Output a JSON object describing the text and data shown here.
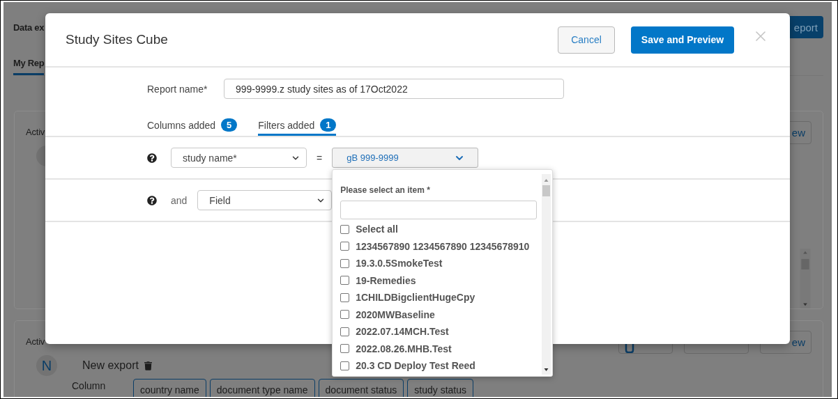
{
  "background": {
    "title": "Data ex",
    "header_button": "eport",
    "tabs": [
      {
        "label": "My Rep",
        "selected": true
      }
    ],
    "cards": [
      {
        "heading": "Activ",
        "buttons": [
          {
            "kind": "text",
            "label": "ew"
          }
        ]
      },
      {
        "heading": "Activ",
        "avatar": "N",
        "name": "New export",
        "column_label": "Column",
        "columns": [
          "country name",
          "document type name",
          "document status",
          "study status"
        ],
        "buttons": [
          {
            "kind": "icon"
          },
          {
            "kind": "blank"
          },
          {
            "kind": "text",
            "label": "ew"
          }
        ]
      }
    ]
  },
  "dialog": {
    "title": "Study Sites Cube",
    "cancel": "Cancel",
    "save": "Save and Preview",
    "report_name": {
      "label": "Report name*",
      "value": "999-9999.z study sites as of 17Oct2022"
    },
    "tabs": [
      {
        "label": "Columns added",
        "count": "5",
        "selected": false
      },
      {
        "label": "Filters added",
        "count": "1",
        "selected": true
      }
    ],
    "filters": [
      {
        "field": "study name*",
        "operator": "=",
        "value": "gB 999-9999",
        "dropdown": {
          "label": "Please select an item *",
          "items": [
            {
              "label": "Select all",
              "checked": false
            },
            {
              "label": "1234567890 1234567890 12345678910",
              "checked": false
            },
            {
              "label": "19.3.0.5SmokeTest",
              "checked": false
            },
            {
              "label": "19-Remedies",
              "checked": false
            },
            {
              "label": "1CHILDBigclientHugeCpy",
              "checked": false
            },
            {
              "label": "2020MWBaseline",
              "checked": false
            },
            {
              "label": "2022.07.14MCH.Test",
              "checked": false
            },
            {
              "label": "2022.08.26.MHB.Test",
              "checked": false
            },
            {
              "label": "20.3 CD Deploy Test Reed",
              "checked": false
            }
          ]
        }
      },
      {
        "connector": "and",
        "field": "Field"
      }
    ]
  }
}
